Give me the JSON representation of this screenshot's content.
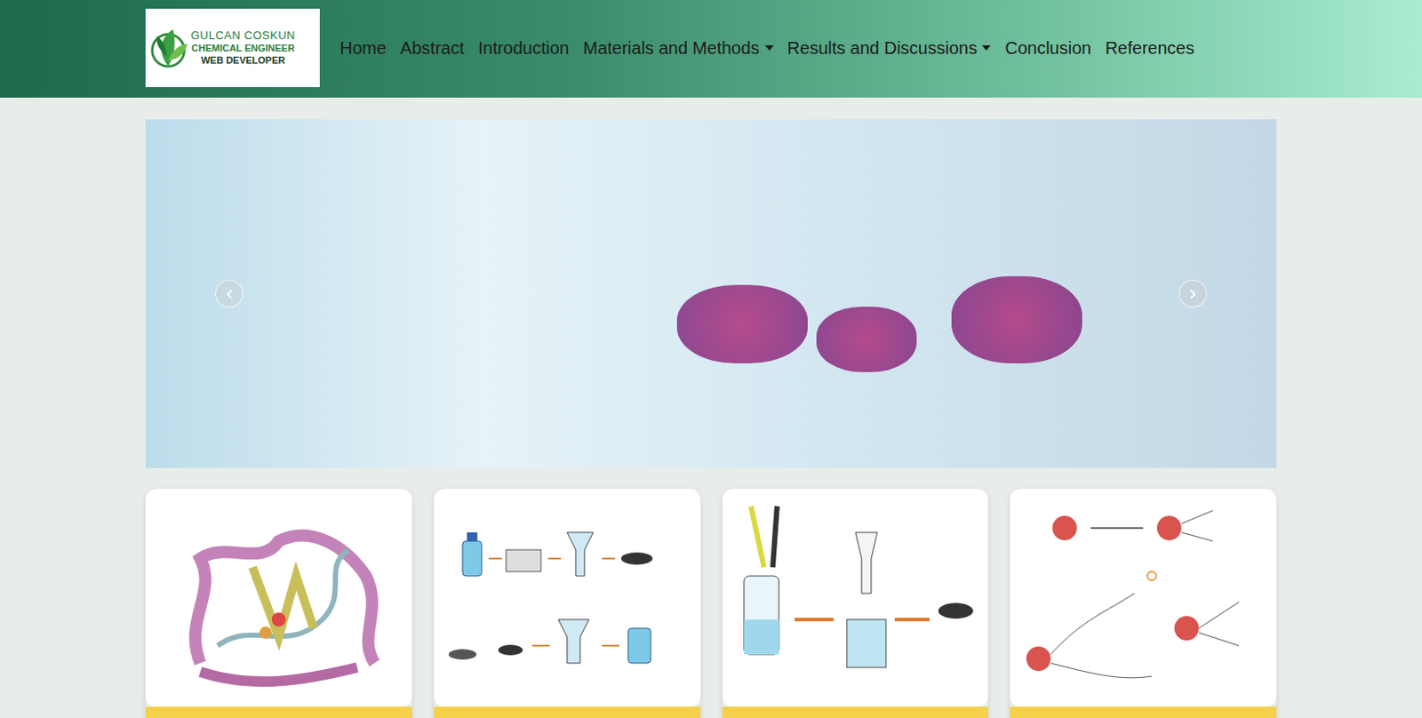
{
  "brand": {
    "lines": [
      "GULCAN COSKUN",
      "CHEMICAL ENGINEER",
      "WEB DEVELOPER"
    ]
  },
  "nav": {
    "items": [
      {
        "label": "Home",
        "dropdown": false
      },
      {
        "label": "Abstract",
        "dropdown": false
      },
      {
        "label": "Introduction",
        "dropdown": false
      },
      {
        "label": "Materials and Methods",
        "dropdown": true
      },
      {
        "label": "Results and Discussions",
        "dropdown": true
      },
      {
        "label": "Conclusion",
        "dropdown": false
      },
      {
        "label": "References",
        "dropdown": false
      }
    ]
  },
  "carousel": {
    "prev": "‹",
    "next": "›"
  },
  "cards": [
    {
      "kind": "protein"
    },
    {
      "kind": "workflow"
    },
    {
      "kind": "immobilization"
    },
    {
      "kind": "chemistry"
    }
  ]
}
